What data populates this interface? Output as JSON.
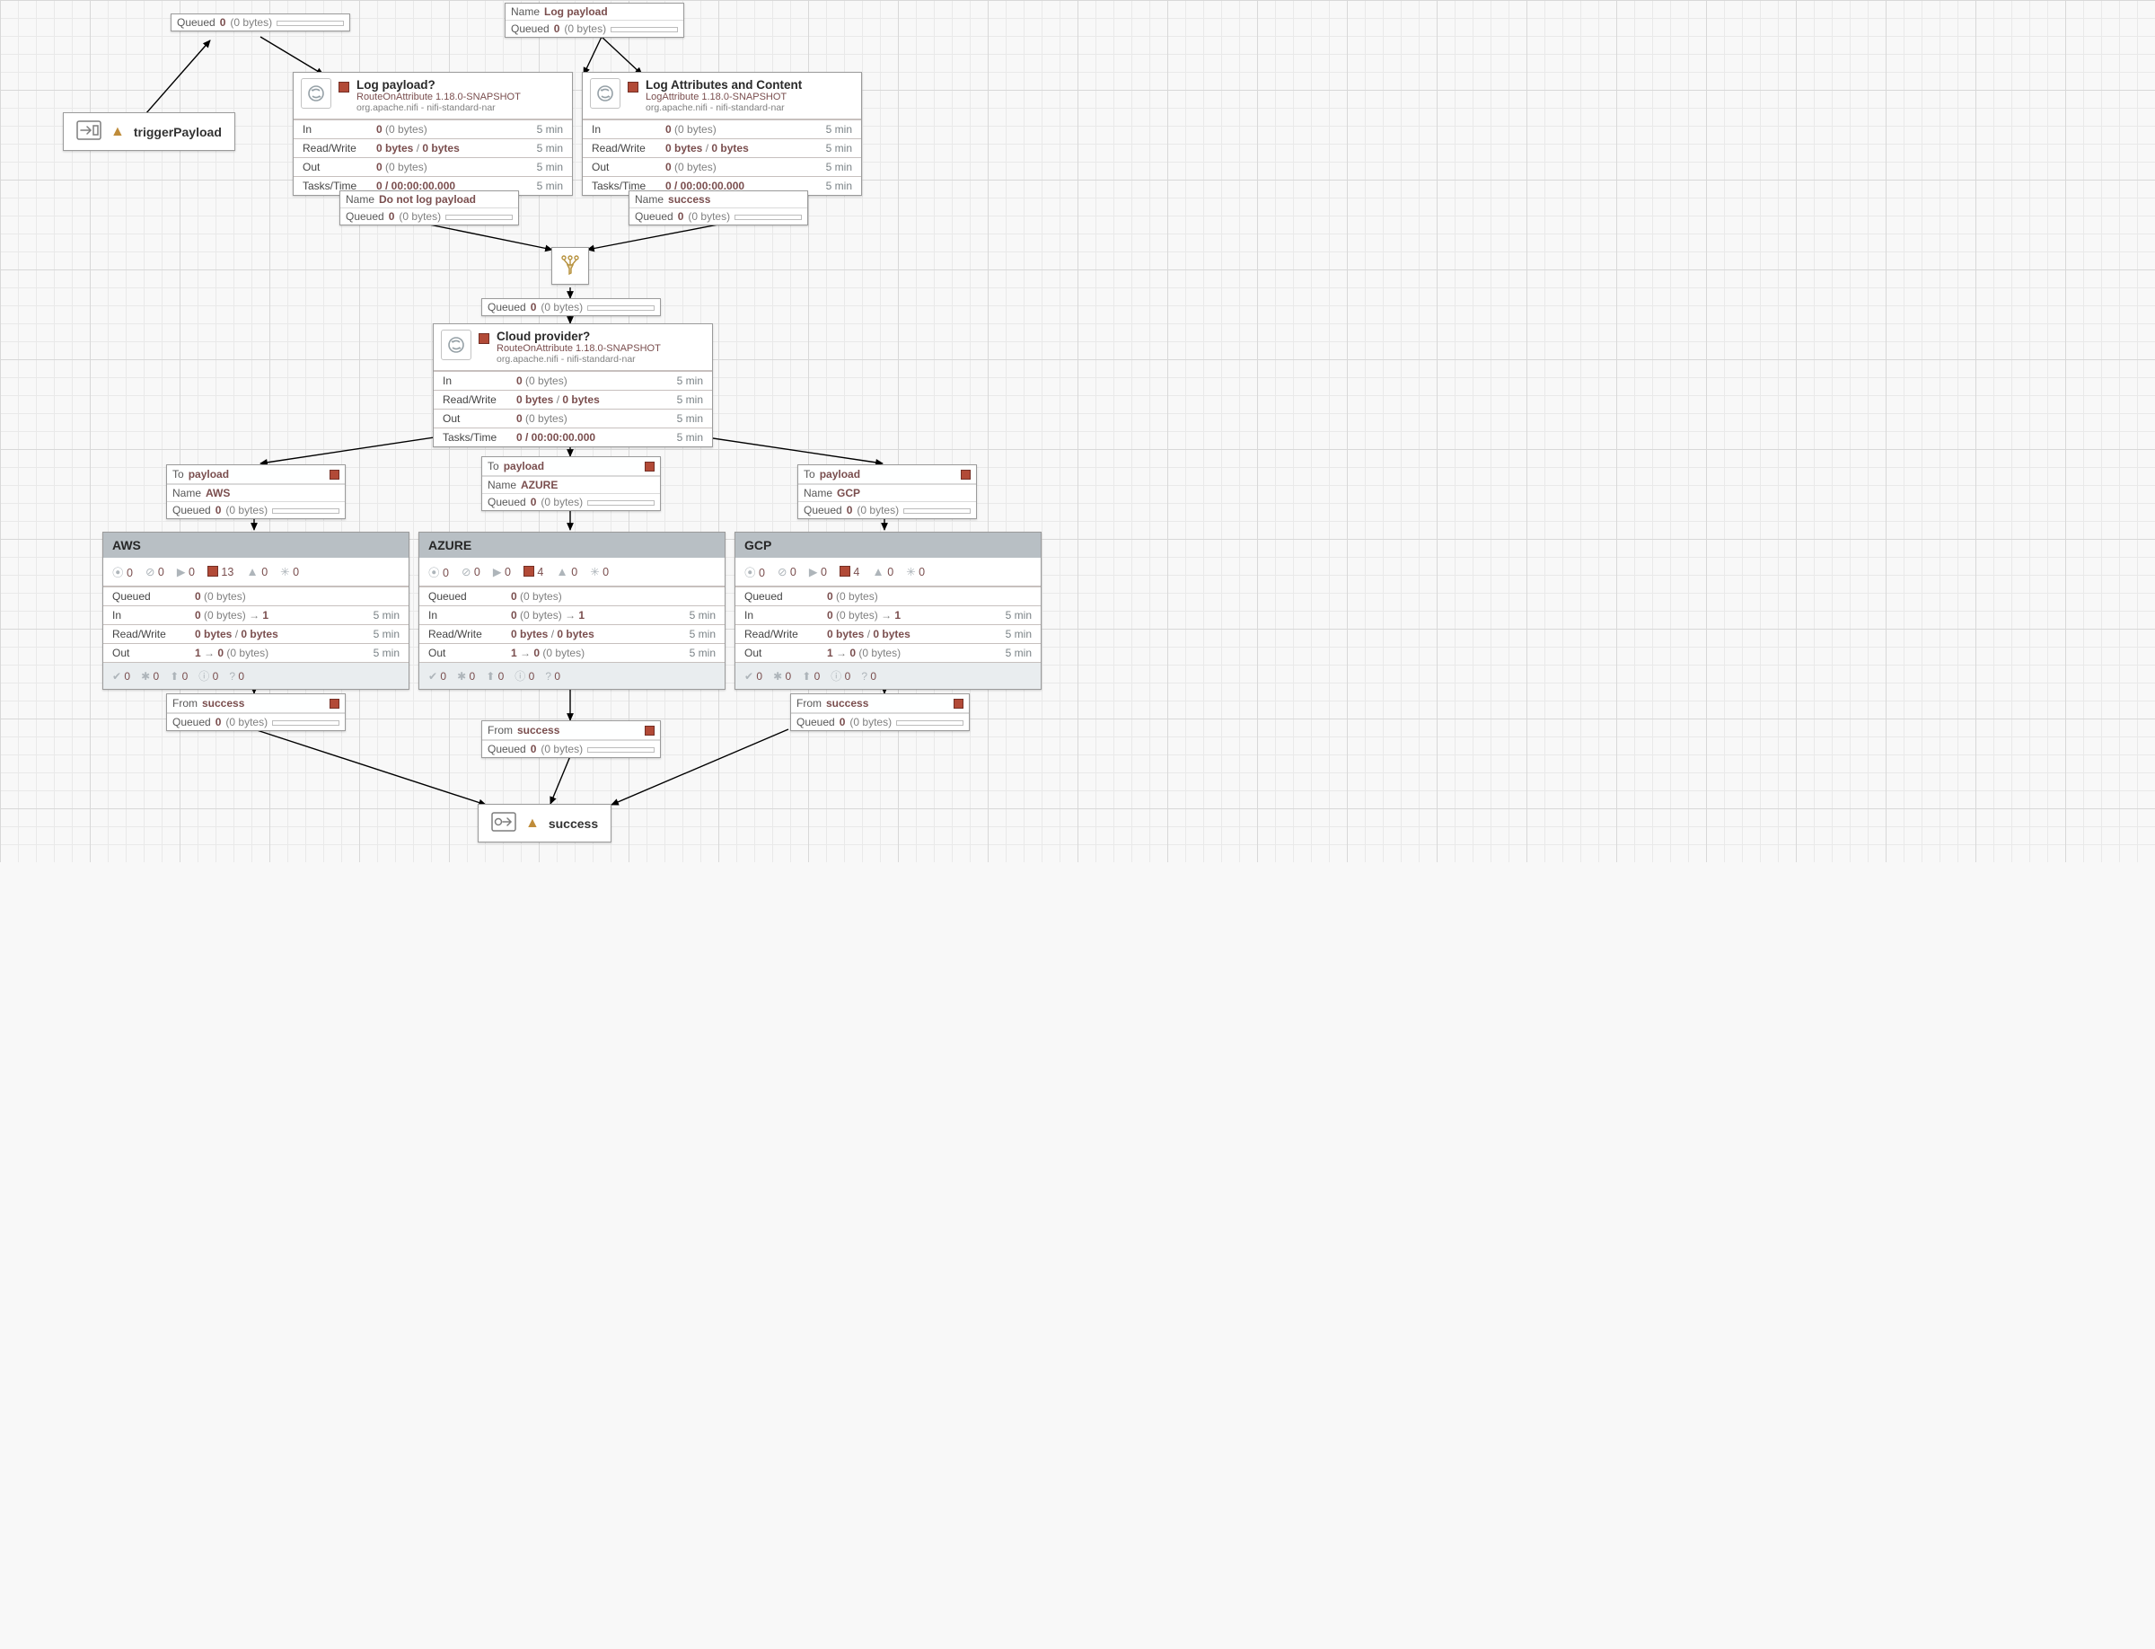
{
  "labels": {
    "name": "Name",
    "queued": "Queued",
    "to": "To",
    "from": "From",
    "in": "In",
    "rw": "Read/Write",
    "out": "Out",
    "tt": "Tasks/Time",
    "five": "5 min"
  },
  "ports": {
    "trigger": {
      "label": "triggerPayload"
    },
    "success": {
      "label": "success"
    }
  },
  "conn_top_queue": {
    "count": "0",
    "bytes": "(0 bytes)"
  },
  "conn_log_payload_name": {
    "name": "Log payload",
    "count": "0",
    "bytes": "(0 bytes)"
  },
  "conn_dont_log": {
    "name": "Do not log payload",
    "count": "0",
    "bytes": "(0 bytes)"
  },
  "conn_success": {
    "name": "success",
    "count": "0",
    "bytes": "(0 bytes)"
  },
  "conn_funnel_queue": {
    "count": "0",
    "bytes": "(0 bytes)"
  },
  "conn_aws": {
    "to": "payload",
    "name": "AWS",
    "count": "0",
    "bytes": "(0 bytes)"
  },
  "conn_azure": {
    "to": "payload",
    "name": "AZURE",
    "count": "0",
    "bytes": "(0 bytes)"
  },
  "conn_gcp": {
    "to": "payload",
    "name": "GCP",
    "count": "0",
    "bytes": "(0 bytes)"
  },
  "conn_from_aws": {
    "from": "success",
    "count": "0",
    "bytes": "(0 bytes)"
  },
  "conn_from_azure": {
    "from": "success",
    "count": "0",
    "bytes": "(0 bytes)"
  },
  "conn_from_gcp": {
    "from": "success",
    "count": "0",
    "bytes": "(0 bytes)"
  },
  "proc_log": {
    "title": "Log payload?",
    "type": "RouteOnAttribute 1.18.0-SNAPSHOT",
    "bundle": "org.apache.nifi - nifi-standard-nar",
    "in_c": "0",
    "in_b": "(0 bytes)",
    "rw_a": "0 bytes",
    "rw_b": "0 bytes",
    "out_c": "0",
    "out_b": "(0 bytes)",
    "tt": "0 / 00:00:00.000"
  },
  "proc_attr": {
    "title": "Log Attributes and Content",
    "type": "LogAttribute 1.18.0-SNAPSHOT",
    "bundle": "org.apache.nifi - nifi-standard-nar",
    "in_c": "0",
    "in_b": "(0 bytes)",
    "rw_a": "0 bytes",
    "rw_b": "0 bytes",
    "out_c": "0",
    "out_b": "(0 bytes)",
    "tt": "0 / 00:00:00.000"
  },
  "proc_cloud": {
    "title": "Cloud provider?",
    "type": "RouteOnAttribute 1.18.0-SNAPSHOT",
    "bundle": "org.apache.nifi - nifi-standard-nar",
    "in_c": "0",
    "in_b": "(0 bytes)",
    "rw_a": "0 bytes",
    "rw_b": "0 bytes",
    "out_c": "0",
    "out_b": "(0 bytes)",
    "tt": "0 / 00:00:00.000"
  },
  "pg_aws": {
    "name": "AWS",
    "stopped": "13",
    "queued_c": "0",
    "queued_b": "(0 bytes)",
    "in_c": "0",
    "in_b": "(0 bytes)",
    "in_ports": "1",
    "rw_a": "0 bytes",
    "rw_b": "0 bytes",
    "out_ports": "1",
    "out_c": "0",
    "out_b": "(0 bytes)"
  },
  "pg_azure": {
    "name": "AZURE",
    "stopped": "4",
    "queued_c": "0",
    "queued_b": "(0 bytes)",
    "in_c": "0",
    "in_b": "(0 bytes)",
    "in_ports": "1",
    "rw_a": "0 bytes",
    "rw_b": "0 bytes",
    "out_ports": "1",
    "out_c": "0",
    "out_b": "(0 bytes)"
  },
  "pg_gcp": {
    "name": "GCP",
    "stopped": "4",
    "queued_c": "0",
    "queued_b": "(0 bytes)",
    "in_c": "0",
    "in_b": "(0 bytes)",
    "in_ports": "1",
    "rw_a": "0 bytes",
    "rw_b": "0 bytes",
    "out_ports": "1",
    "out_c": "0",
    "out_b": "(0 bytes)"
  },
  "zero": "0",
  "arrow": "→"
}
